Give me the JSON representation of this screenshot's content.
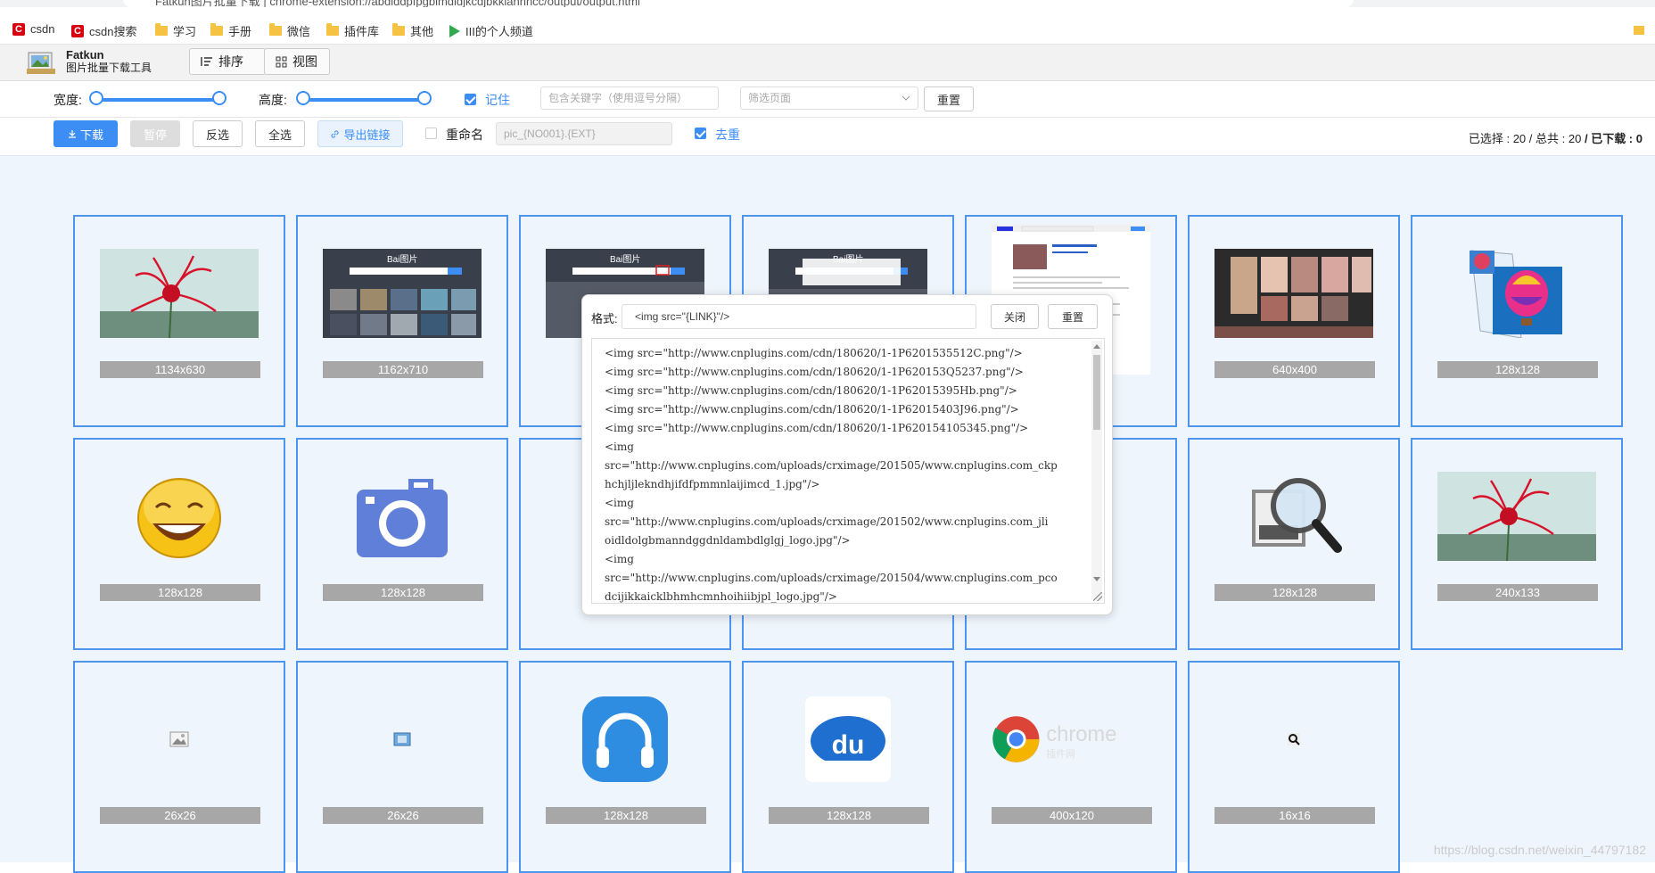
{
  "browser": {
    "url_text": "Fatkun图片批量下载  |  chrome-extension://abdlddpfpgbimdldjkcdjbkklahnncc/output/output.html",
    "bookmarks": [
      {
        "icon": "csdn-icon",
        "label": "csdn"
      },
      {
        "icon": "csdn-icon",
        "label": "csdn搜索"
      },
      {
        "icon": "folder-icon",
        "label": "学习"
      },
      {
        "icon": "folder-icon",
        "label": "手册"
      },
      {
        "icon": "folder-icon",
        "label": "微信"
      },
      {
        "icon": "folder-icon",
        "label": "插件库"
      },
      {
        "icon": "folder-icon",
        "label": "其他"
      },
      {
        "icon": "play-icon",
        "label": "III的个人频道"
      }
    ]
  },
  "app": {
    "name": "Fatkun",
    "subtitle": "图片批量下载工具",
    "sort_label": "排序",
    "view_label": "视图"
  },
  "filters": {
    "width_label": "宽度:",
    "height_label": "高度:",
    "remember_label": "记住",
    "remember_checked": true,
    "keyword_placeholder": "包含关键字（使用逗号分隔）",
    "page_filter_placeholder": "筛选页面",
    "reset_label": "重置",
    "width_range": [
      0,
      1
    ],
    "height_range": [
      0,
      1
    ]
  },
  "actions": {
    "download_label": "下载",
    "pause_label": "暂停",
    "invert_label": "反选",
    "select_all_label": "全选",
    "export_label": "导出链接",
    "rename_label": "重命名",
    "rename_checked": false,
    "rename_pattern": "pic_{NO001}.{EXT}",
    "dedupe_label": "去重",
    "dedupe_checked": true
  },
  "stats": {
    "selected_label": "已选择 :",
    "selected": "20",
    "total_label": "/ 总共 :",
    "total": "20",
    "downloaded_label": "/ 已下载 :",
    "downloaded": "0"
  },
  "images": [
    {
      "size": "1134x630",
      "kind": "flower"
    },
    {
      "size": "1162x710",
      "kind": "baidu"
    },
    {
      "size": "",
      "kind": "baidu2"
    },
    {
      "size": "",
      "kind": "baidu3"
    },
    {
      "size": "",
      "kind": "webpage"
    },
    {
      "size": "640x400",
      "kind": "gallery"
    },
    {
      "size": "128x128",
      "kind": "balloon"
    },
    {
      "size": "128x128",
      "kind": "smiley"
    },
    {
      "size": "128x128",
      "kind": "camera"
    },
    {
      "size": "",
      "kind": "blank"
    },
    {
      "size": "",
      "kind": "blank"
    },
    {
      "size": "",
      "kind": "blank"
    },
    {
      "size": "128x128",
      "kind": "magnifier"
    },
    {
      "size": "240x133",
      "kind": "flower"
    },
    {
      "size": "26x26",
      "kind": "tiny-image"
    },
    {
      "size": "26x26",
      "kind": "tiny-image2"
    },
    {
      "size": "128x128",
      "kind": "headphones"
    },
    {
      "size": "128x128",
      "kind": "du"
    },
    {
      "size": "400x120",
      "kind": "chrome"
    },
    {
      "size": "16x16",
      "kind": "tiny-search"
    }
  ],
  "export_dialog": {
    "format_label": "格式:",
    "format_value": "<img src=\"{LINK}\"/>",
    "close_label": "关闭",
    "reset_label": "重置",
    "lines": [
      "<img src=\"http://www.cnplugins.com/cdn/180620/1-1P6201535512C.png\"/>",
      "<img src=\"http://www.cnplugins.com/cdn/180620/1-1P620153Q5237.png\"/>",
      "<img src=\"http://www.cnplugins.com/cdn/180620/1-1P62015395Hb.png\"/>",
      "<img src=\"http://www.cnplugins.com/cdn/180620/1-1P62015403J96.png\"/>",
      "<img src=\"http://www.cnplugins.com/cdn/180620/1-1P620154105345.png\"/>",
      "<img",
      "src=\"http://www.cnplugins.com/uploads/crximage/201505/www.cnplugins.com_ckp",
      "hchjljlekndhjifdfpmmnlaijimcd_1.jpg\"/>",
      "<img",
      "src=\"http://www.cnplugins.com/uploads/crximage/201502/www.cnplugins.com_jli",
      "oidldolgbmanndggdnldambdlglgj_logo.jpg\"/>",
      "<img",
      "src=\"http://www.cnplugins.com/uploads/crximage/201504/www.cnplugins.com_pco",
      "dcijikkaicklbhmhcmnhoihiibjpl_logo.jpg\"/>"
    ]
  },
  "watermark": "https://blog.csdn.net/weixin_44797182"
}
